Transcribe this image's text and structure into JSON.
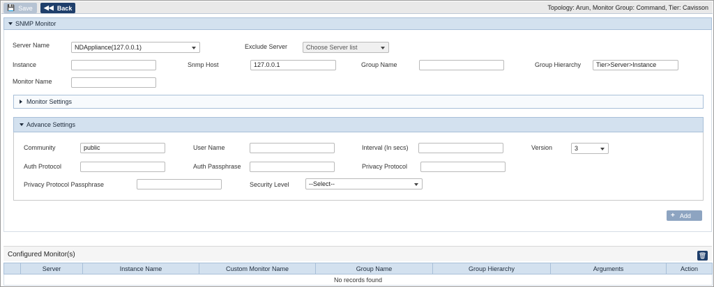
{
  "toolbar": {
    "save_label": "Save",
    "back_label": "Back",
    "topology_text": "Topology: Arun, Monitor Group: Command, Tier: Cavisson"
  },
  "snmp": {
    "header": "SNMP Monitor",
    "server_name_label": "Server Name",
    "server_name_value": "NDAppliance(127.0.0.1)",
    "exclude_server_label": "Exclude Server",
    "exclude_server_value": "Choose Server list",
    "instance_label": "Instance",
    "instance_value": "",
    "snmp_host_label": "Snmp Host",
    "snmp_host_value": "127.0.0.1",
    "group_name_label": "Group Name",
    "group_name_value": "",
    "group_hierarchy_label": "Group Hierarchy",
    "group_hierarchy_value": "Tier>Server>Instance",
    "monitor_name_label": "Monitor Name",
    "monitor_name_value": ""
  },
  "monitor_settings": {
    "label": "Monitor Settings"
  },
  "advance_settings": {
    "label": "Advance Settings",
    "community_label": "Community",
    "community_value": "public",
    "user_name_label": "User Name",
    "user_name_value": "",
    "interval_label": "Interval (In secs)",
    "interval_value": "",
    "version_label": "Version",
    "version_value": "3",
    "auth_protocol_label": "Auth Protocol",
    "auth_protocol_value": "",
    "auth_passphrase_label": "Auth Passphrase",
    "auth_passphrase_value": "",
    "privacy_protocol_label": "Privacy Protocol",
    "privacy_protocol_value": "",
    "privacy_passphrase_label": "Privacy Protocol Passphrase",
    "privacy_passphrase_value": "",
    "security_level_label": "Security Level",
    "security_level_value": "--Select--"
  },
  "add_label": "Add",
  "configured": {
    "title": "Configured Monitor(s)",
    "columns": [
      "",
      "Server",
      "Instance Name",
      "Custom Monitor Name",
      "Group Name",
      "Group Hierarchy",
      "Arguments",
      "Action"
    ],
    "empty_message": "No records found"
  },
  "icons": {
    "save": "floppy-disk-icon",
    "back": "double-chevron-left-icon",
    "add": "plus-icon",
    "delete": "trash-icon"
  },
  "colors": {
    "accent": "#1f3f6b",
    "header_bg": "#d3e1ef",
    "disabled_button": "#b6c3d3",
    "add_button": "#8da4c1"
  }
}
